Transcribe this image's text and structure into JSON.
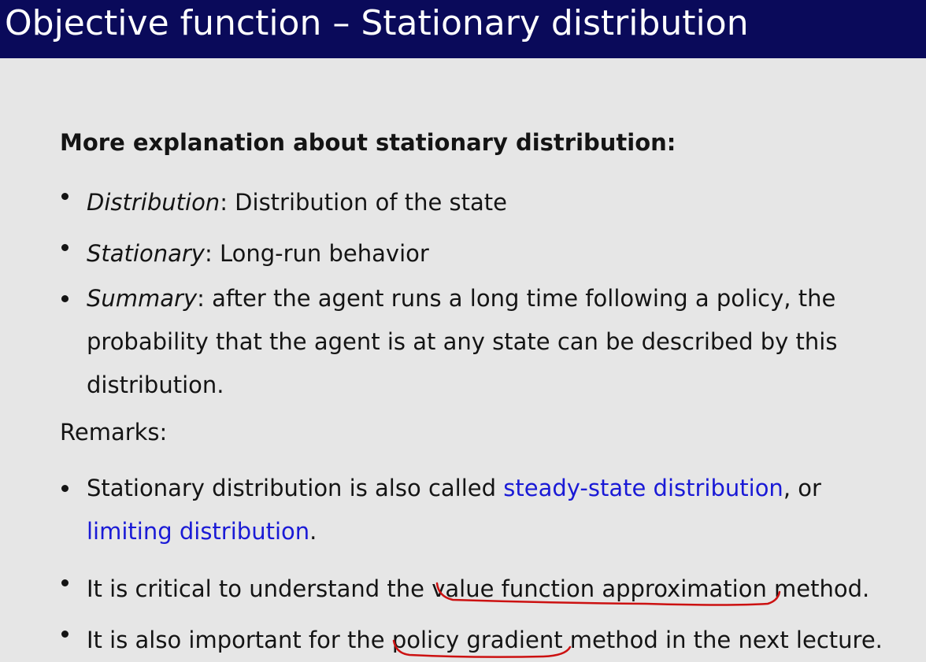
{
  "slide": {
    "title": "Objective function – Stationary distribution",
    "heading": "More explanation about stationary distribution:",
    "bullets": [
      {
        "term": "Distribution",
        "text": ": Distribution of the state"
      },
      {
        "term": "Stationary",
        "text": ": Long-run behavior"
      },
      {
        "term": "Summary",
        "text_line1": ": after the agent runs a long time following a policy, the",
        "text_line2": "probability that the agent is at any state can be described by this",
        "text_line3": "distribution."
      }
    ],
    "remarks_label": "Remarks:",
    "remarks": [
      {
        "prefix": "Stationary distribution is also called ",
        "link1": "steady-state distribution",
        "mid": ", or",
        "link2": "limiting distribution",
        "suffix": "."
      },
      {
        "prefix": "It is critical to understand the ",
        "highlight": "value function approximation",
        "suffix": " method."
      },
      {
        "prefix": "It is also important for the ",
        "highlight": "policy gradient",
        "suffix": " method in the next lecture."
      }
    ],
    "colors": {
      "title_bar": "#0a0a5a",
      "background": "#e6e6e6",
      "link": "#1a1ad6",
      "annotation": "#cc1111"
    }
  }
}
